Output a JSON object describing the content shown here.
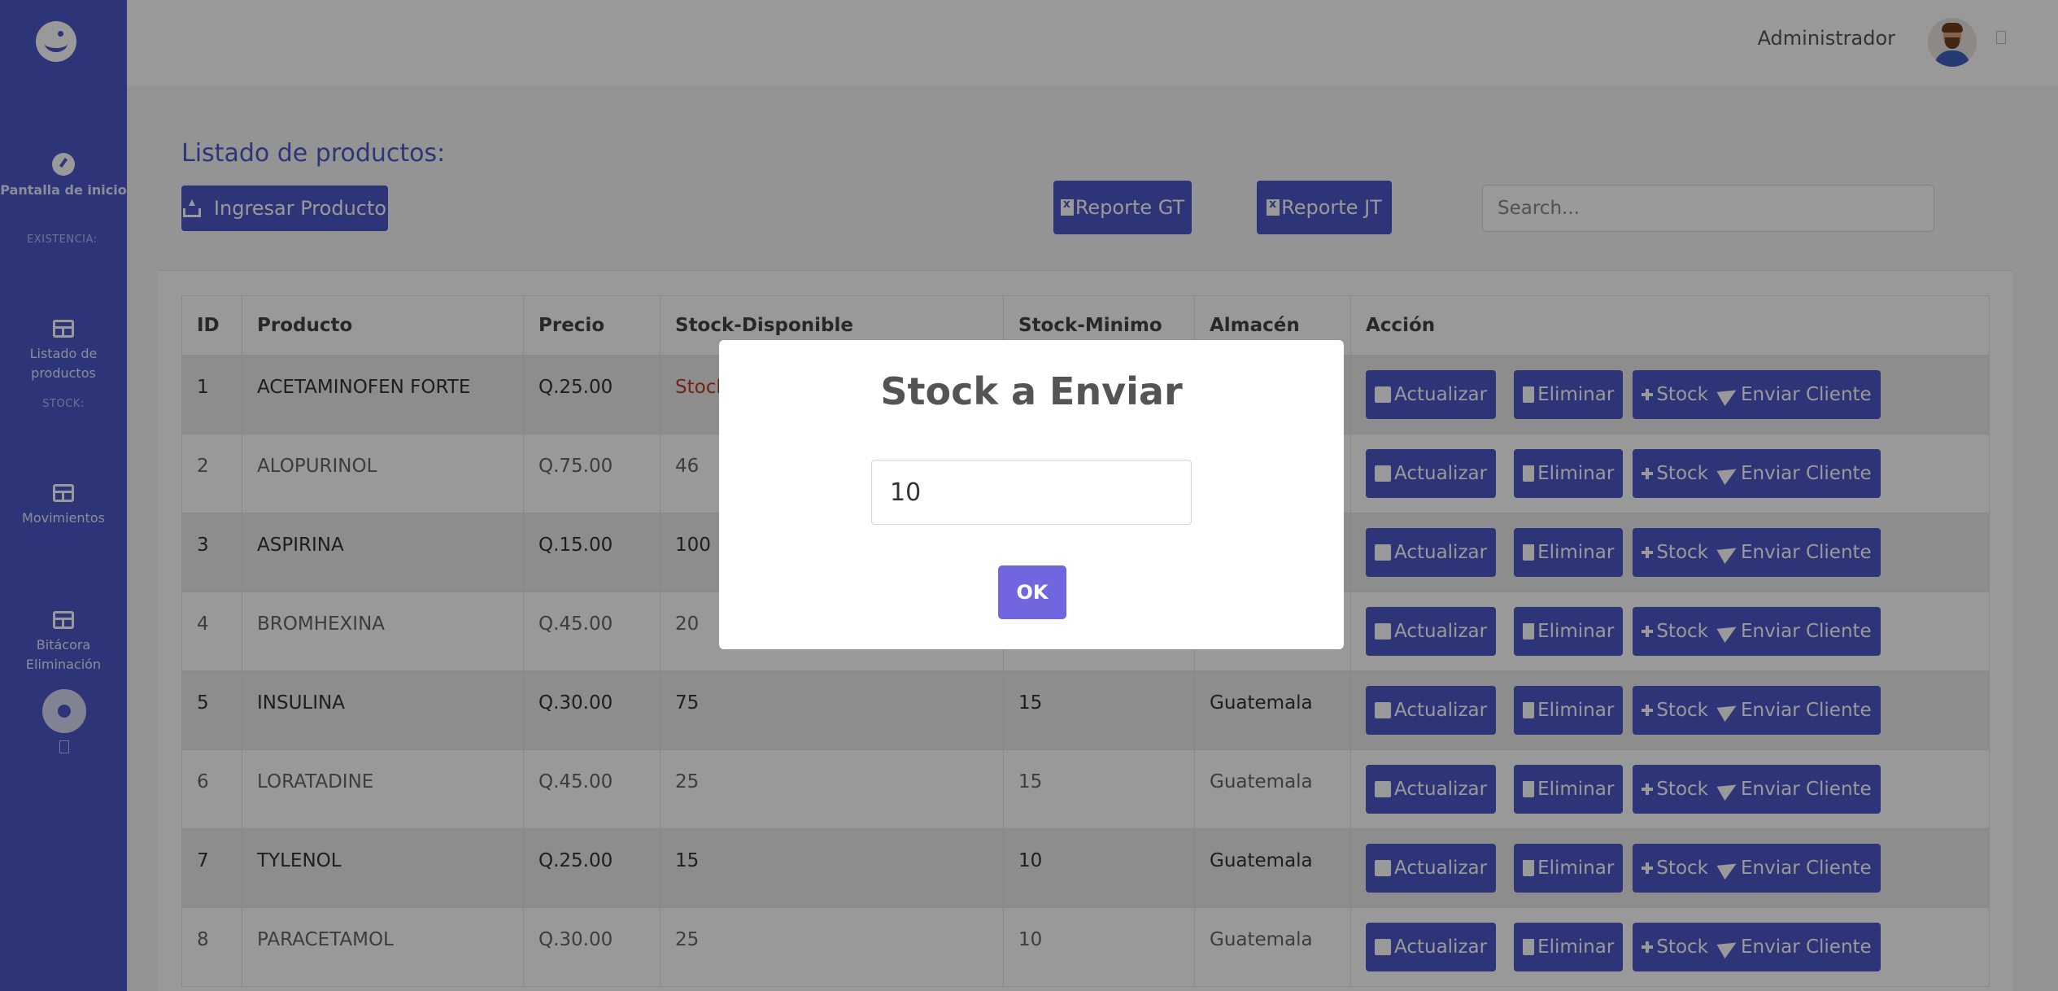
{
  "sidebar": {
    "items": [
      {
        "label": "Pantalla de inicio"
      },
      {
        "label": "Listado de productos"
      },
      {
        "label": "Movimientos"
      },
      {
        "label": "Bitácora Eliminación"
      }
    ],
    "sections": [
      "EXISTENCIA:",
      "STOCK:"
    ]
  },
  "header": {
    "user_name": "Administrador"
  },
  "page": {
    "title": "Listado de productos:",
    "ingresar_label": "Ingresar Producto",
    "reporte_gt_label": "Reporte GT",
    "reporte_jt_label": "Reporte JT",
    "search_placeholder": "Search..."
  },
  "table": {
    "columns": [
      "ID",
      "Producto",
      "Precio",
      "Stock-Disponible",
      "Stock-Minimo",
      "Almacén",
      "Acción"
    ],
    "rows": [
      {
        "id": "1",
        "producto": "ACETAMINOFEN FORTE",
        "precio": "Q.25.00",
        "stock": "Stock",
        "minimo": "",
        "almacen": ""
      },
      {
        "id": "2",
        "producto": "ALOPURINOL",
        "precio": "Q.75.00",
        "stock": "46",
        "minimo": "",
        "almacen": ""
      },
      {
        "id": "3",
        "producto": "ASPIRINA",
        "precio": "Q.15.00",
        "stock": "100",
        "minimo": "",
        "almacen": ""
      },
      {
        "id": "4",
        "producto": "BROMHEXINA",
        "precio": "Q.45.00",
        "stock": "20",
        "minimo": "",
        "almacen": ""
      },
      {
        "id": "5",
        "producto": "INSULINA",
        "precio": "Q.30.00",
        "stock": "75",
        "minimo": "15",
        "almacen": "Guatemala"
      },
      {
        "id": "6",
        "producto": "LORATADINE",
        "precio": "Q.45.00",
        "stock": "25",
        "minimo": "15",
        "almacen": "Guatemala"
      },
      {
        "id": "7",
        "producto": "TYLENOL",
        "precio": "Q.25.00",
        "stock": "15",
        "minimo": "10",
        "almacen": "Guatemala"
      },
      {
        "id": "8",
        "producto": "PARACETAMOL",
        "precio": "Q.30.00",
        "stock": "25",
        "minimo": "10",
        "almacen": "Guatemala"
      }
    ],
    "actions": {
      "actualizar": "Actualizar",
      "eliminar": "Eliminar",
      "stock": "Stock",
      "enviar": "Enviar Cliente"
    }
  },
  "modal": {
    "title": "Stock a Enviar",
    "input_value": "10",
    "ok_label": "OK"
  }
}
